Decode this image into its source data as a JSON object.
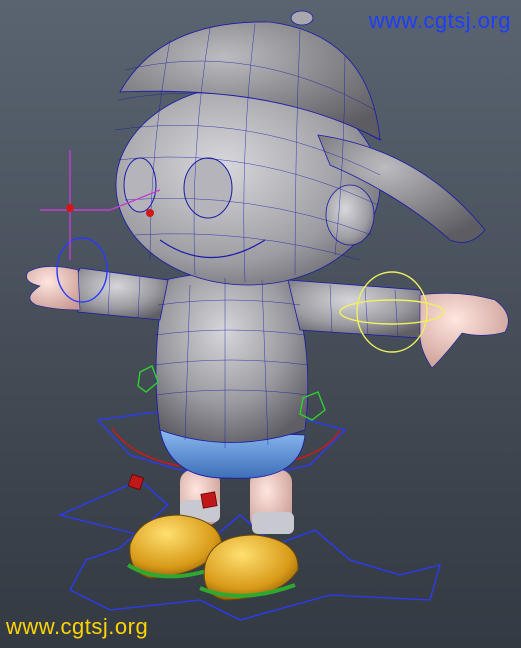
{
  "viewport": {
    "background_top": "#5a6470",
    "background_bottom": "#343a42"
  },
  "model": {
    "wireframe_color": "#1a1aa8",
    "shirt_color": "#a6a6ab",
    "cap_color": "#8e8e92",
    "skin_color": "#f0cfc8",
    "shorts_color": "#5a8fd6",
    "shoe_color": "#e6a51c"
  },
  "rig": {
    "control_blue": "#2a3aff",
    "control_yellow": "#f0f060",
    "control_green": "#30d030",
    "control_red": "#d01818",
    "control_magenta": "#c040d0"
  },
  "watermark_top": "www.cgtsj.org",
  "watermark_bottom": "www.cgtsj.org"
}
